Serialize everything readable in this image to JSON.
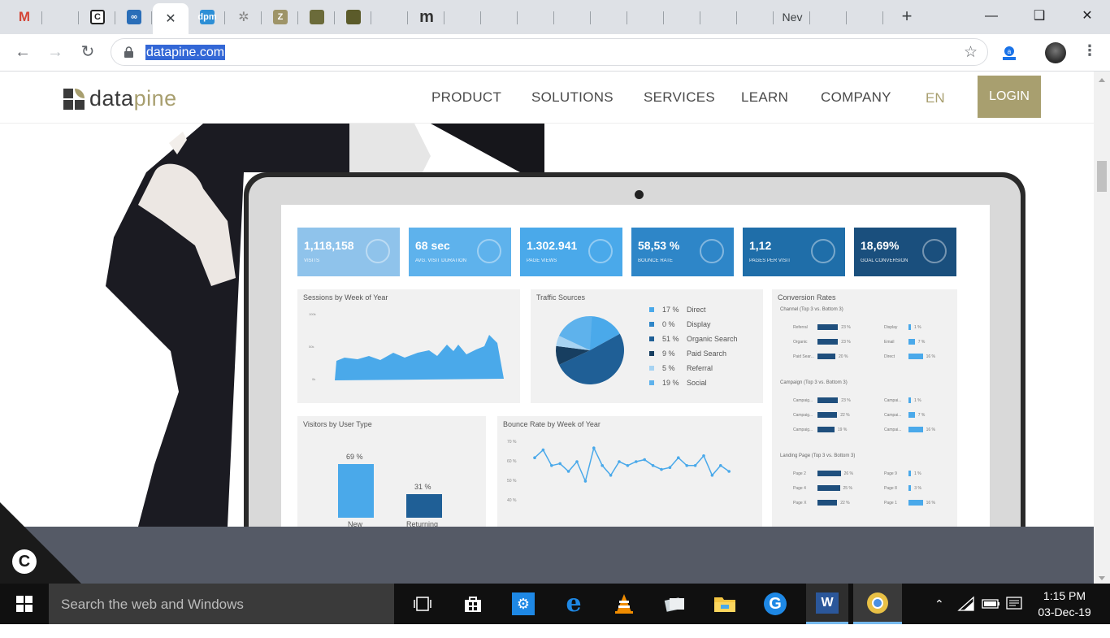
{
  "browser": {
    "tabs": [
      {
        "icon": "gmail-icon",
        "label": "M",
        "color": "#dadce0",
        "fg": "#d44638"
      },
      {
        "icon": "globe-icon",
        "label": "",
        "color": "#5f6368"
      },
      {
        "icon": "c-icon",
        "label": "C",
        "color": "#222"
      },
      {
        "icon": "link-icon",
        "label": "∞",
        "color": "#2a6eb8"
      },
      {
        "icon": "close-icon",
        "label": "✕",
        "active": true
      },
      {
        "icon": "dpm-icon",
        "label": "dpm",
        "color": "#2d8fd6"
      },
      {
        "icon": "snowflake-icon",
        "label": "✲",
        "color": "#999"
      },
      {
        "icon": "z-icon",
        "label": "Z",
        "color": "#9e9468"
      },
      {
        "icon": "grid-icon",
        "label": "",
        "color": "#6b6b3a"
      },
      {
        "icon": "grid-icon",
        "label": "",
        "color": "#5b5b2a"
      },
      {
        "icon": "wave-icon",
        "label": "",
        "color": "#a8a070"
      },
      {
        "icon": "m-icon",
        "label": "m",
        "color": "#333"
      },
      {
        "icon": "e-icon",
        "label": "",
        "color": "#a89f6f"
      },
      {
        "icon": "e-icon",
        "label": "",
        "color": "#a89f6f"
      },
      {
        "icon": "chain-icon",
        "label": "",
        "color": "#999"
      },
      {
        "icon": "aperture-icon",
        "label": "",
        "color": "#1d7fb8"
      },
      {
        "icon": "wave-icon",
        "label": "",
        "color": "#a8a070"
      },
      {
        "icon": "e-icon",
        "label": "",
        "color": "#a89f6f"
      },
      {
        "icon": "lines-icon",
        "label": "",
        "color": "#a89f6f"
      },
      {
        "icon": "lines-icon",
        "label": "",
        "color": "#a89f6f"
      },
      {
        "icon": "bars-icon",
        "label": "",
        "color": "#333"
      },
      {
        "icon": "text-tab",
        "label": "Nev"
      },
      {
        "icon": "bars-icon",
        "label": "",
        "color": "#333"
      },
      {
        "icon": "lines-icon",
        "label": "",
        "color": "#a89f6f"
      }
    ],
    "url": "datapine.com"
  },
  "site": {
    "logo": {
      "left": "data",
      "right": "pine"
    },
    "menu": [
      "PRODUCT",
      "SOLUTIONS",
      "SERVICES",
      "LEARN",
      "COMPANY"
    ],
    "lang": "EN",
    "login": "LOGIN"
  },
  "dashboard": {
    "kpis": [
      {
        "value": "1,118,158",
        "label": "Visits",
        "color": "#8fc3eb"
      },
      {
        "value": "68 sec",
        "label": "Avg. visit duration",
        "color": "#5eb2ec"
      },
      {
        "value": "1.302.941",
        "label": "Page views",
        "color": "#4aa9ea"
      },
      {
        "value": "58,53 %",
        "label": "Bounce rate",
        "color": "#2e86c8"
      },
      {
        "value": "1,12",
        "label": "Pages per visit",
        "color": "#1f6ea9"
      },
      {
        "value": "18,69%",
        "label": "Goal conversion",
        "color": "#1a4f7d"
      }
    ],
    "panels": {
      "sessions": "Sessions by Week of Year",
      "traffic": "Traffic Sources",
      "conversion": "Conversion Rates",
      "visitors": "Visitors by User Type",
      "bounce": "Bounce Rate by Week of Year"
    },
    "traffic_sources": [
      {
        "pct": "17 %",
        "name": "Direct",
        "color": "#4aa9ea"
      },
      {
        "pct": "0 %",
        "name": "Display",
        "color": "#2e86c8"
      },
      {
        "pct": "51 %",
        "name": "Organic Search",
        "color": "#1f5f96"
      },
      {
        "pct": "9 %",
        "name": "Paid Search",
        "color": "#173e60"
      },
      {
        "pct": "5 %",
        "name": "Referral",
        "color": "#a7d3f2"
      },
      {
        "pct": "19 %",
        "name": "Social",
        "color": "#5eb2ec"
      }
    ],
    "conversion": {
      "channel_title": "Channel (Top 3 vs. Bottom 3)",
      "campaign_title": "Campaign (Top 3 vs. Bottom 3)",
      "landing_title": "Landing Page (Top 3 vs. Bottom 3)",
      "channel_left": [
        {
          "name": "Referral",
          "val": "23 %",
          "w": 0.23
        },
        {
          "name": "Organic",
          "val": "23 %",
          "w": 0.23
        },
        {
          "name": "Paid Sear...",
          "val": "20 %",
          "w": 0.2
        }
      ],
      "channel_right": [
        {
          "name": "Display",
          "val": "1 %",
          "w": 0.01
        },
        {
          "name": "Email",
          "val": "7 %",
          "w": 0.07
        },
        {
          "name": "Direct",
          "val": "16 %",
          "w": 0.16
        }
      ],
      "campaign_left": [
        {
          "name": "Campaig...",
          "val": "23 %",
          "w": 0.23
        },
        {
          "name": "Campaig...",
          "val": "22 %",
          "w": 0.22
        },
        {
          "name": "Campaig...",
          "val": "19 %",
          "w": 0.19
        }
      ],
      "campaign_right": [
        {
          "name": "Campai...",
          "val": "1 %",
          "w": 0.01
        },
        {
          "name": "Campai...",
          "val": "7 %",
          "w": 0.07
        },
        {
          "name": "Campai...",
          "val": "16 %",
          "w": 0.16
        }
      ],
      "landing_left": [
        {
          "name": "Page 2",
          "val": "26 %",
          "w": 0.26
        },
        {
          "name": "Page 4",
          "val": "25 %",
          "w": 0.25
        },
        {
          "name": "Page X",
          "val": "22 %",
          "w": 0.22
        }
      ],
      "landing_right": [
        {
          "name": "Page 9",
          "val": "1 %",
          "w": 0.01
        },
        {
          "name": "Page 8",
          "val": "3 %",
          "w": 0.03
        },
        {
          "name": "Page 1",
          "val": "16 %",
          "w": 0.16
        }
      ]
    },
    "visitors": [
      {
        "name": "New",
        "pct": "69 %",
        "v": 69,
        "color": "#4aa9ea"
      },
      {
        "name": "Returning",
        "pct": "31 %",
        "v": 31,
        "color": "#1f5f96"
      }
    ],
    "sessions_y": [
      "100k",
      "50k",
      "0k"
    ],
    "bounce_y": [
      "70 %",
      "60 %",
      "50 %",
      "40 %"
    ]
  },
  "taskbar": {
    "search_placeholder": "Search the web and Windows",
    "time": "1:15 PM",
    "date": "03-Dec-19"
  }
}
